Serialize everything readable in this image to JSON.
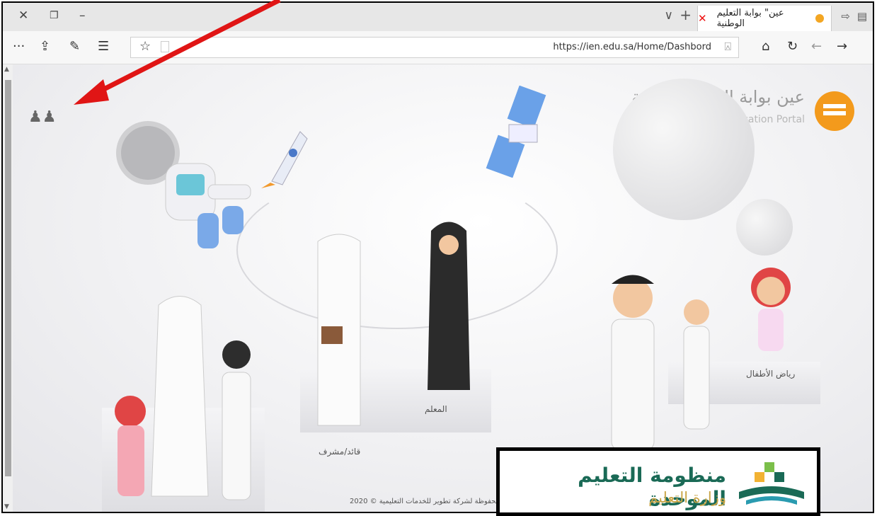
{
  "browser": {
    "tab_title": "عين\" بوابة التعليم الوطنية",
    "url": "https://ien.edu.sa/Home/Dashbord",
    "icons": [
      "close-icon",
      "restore-icon",
      "minimize-icon",
      "tab-dropdown-icon",
      "new-tab-icon",
      "tab-close-icon",
      "set-aside-icon",
      "tab-preview-icon",
      "more-icon",
      "share-icon",
      "pen-icon",
      "favorites-icon",
      "star-icon",
      "reading-view-icon",
      "lock-icon",
      "home-icon",
      "refresh-icon",
      "back-icon",
      "forward-icon"
    ]
  },
  "page": {
    "logo_ar": "عين بوابة التعليم الوطنية",
    "logo_en": "iEN National Education Portal",
    "roles": {
      "kindergarten": "رياض الأطفال",
      "teacher": "المعلم",
      "leader": "قائد/مشرف"
    },
    "copyright": "محفوظة لشركة تطوير للخدمات التعليمية © 2020"
  },
  "banner": {
    "title": "منظومة التعليم الموحدة",
    "subtitle": "وزارة التعليم"
  },
  "colors": {
    "arrow": "#e01515",
    "logo_orange": "#f39a1c",
    "banner_green": "#1a6a56",
    "banner_gold": "#c9a546"
  }
}
